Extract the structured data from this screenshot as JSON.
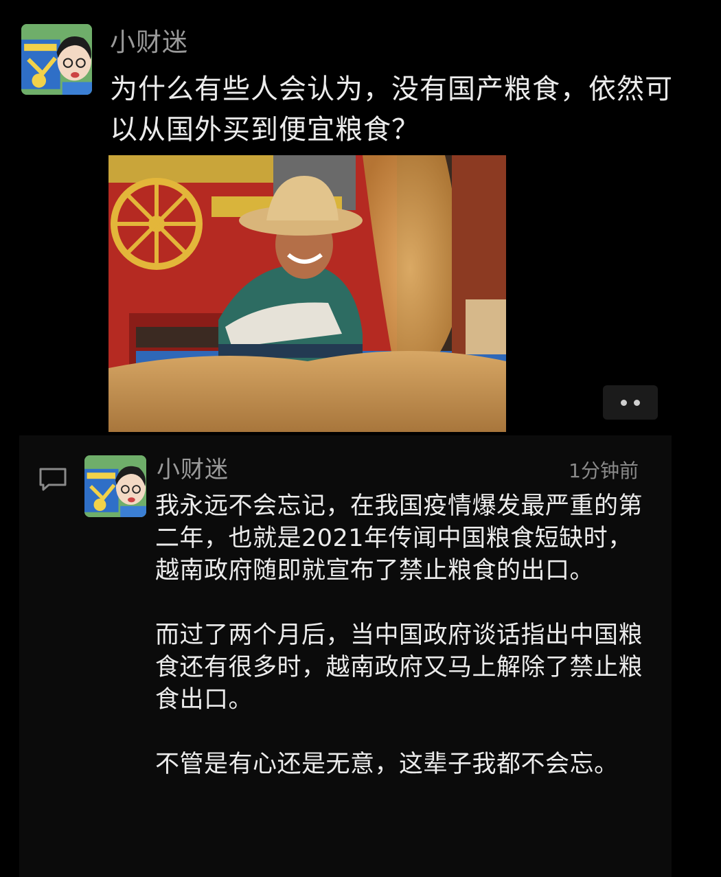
{
  "post": {
    "author": "小财迷",
    "text": "为什么有些人会认为，没有国产粮食，依然可以从国外买到便宜粮食？",
    "avatar_icon": "child-avatar",
    "photo_icon": "farmer-grain-harvest-photo",
    "more_icon": "more-dots-icon"
  },
  "reply": {
    "author": "小财迷",
    "time": "1分钟前",
    "comment_icon": "comment-bubble-icon",
    "paragraphs": [
      "我永远不会忘记，在我国疫情爆发最严重的第二年，也就是2021年传闻中国粮食短缺时，越南政府随即就宣布了禁止粮食的出口。",
      "而过了两个月后，当中国政府谈话指出中国粮食还有很多时，越南政府又马上解除了禁止粮食出口。",
      "不管是有心还是无意，这辈子我都不会忘。"
    ]
  },
  "colors": {
    "background": "#000000",
    "panel": "#0b0b0b",
    "name_text": "#9a9a9a",
    "body_text": "#ececec"
  }
}
